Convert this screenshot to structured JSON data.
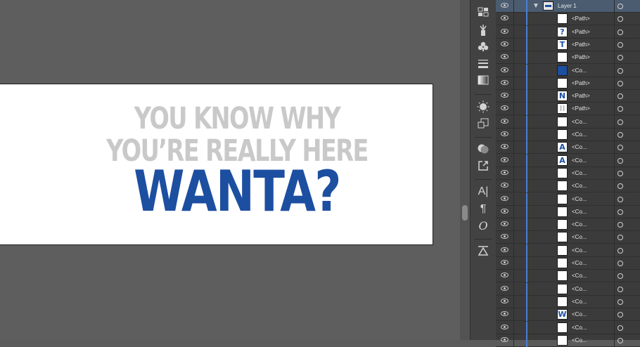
{
  "artboard": {
    "line1": "YOU KNOW WHY",
    "line2": "YOU’RE REALLY HERE",
    "line3": "WANTA?"
  },
  "tools": [
    "swatch-grid-icon",
    "brush-library-icon",
    "symbols-icon",
    "stroke-icon",
    "gradient-icon",
    "appearance-icon",
    "graphic-styles-icon",
    "pathfinder-icon",
    "export-icon",
    "character-icon",
    "paragraph-icon",
    "opentype-icon",
    "align-icon"
  ],
  "tool_glyphs": {
    "character": "A|",
    "paragraph": "¶",
    "opentype": "O"
  },
  "layers": {
    "top_layer": "Layer 1",
    "rows": [
      {
        "name": "<Path>",
        "thumb": "",
        "kind": "white"
      },
      {
        "name": "<Path>",
        "thumb": "?",
        "kind": "letter"
      },
      {
        "name": "<Path>",
        "thumb": "T",
        "kind": "letter"
      },
      {
        "name": "<Path>",
        "thumb": "",
        "kind": "white"
      },
      {
        "name": "<Co...",
        "thumb": "",
        "kind": "blue"
      },
      {
        "name": "<Path>",
        "thumb": "",
        "kind": "white"
      },
      {
        "name": "<Path>",
        "thumb": "N",
        "kind": "letter"
      },
      {
        "name": "<Path>",
        "thumb": "II",
        "kind": "gray"
      },
      {
        "name": "<Co...",
        "thumb": "",
        "kind": "white"
      },
      {
        "name": "<Co...",
        "thumb": "",
        "kind": "white"
      },
      {
        "name": "<Co...",
        "thumb": "A",
        "kind": "letter"
      },
      {
        "name": "<Co...",
        "thumb": "A",
        "kind": "letter"
      },
      {
        "name": "<Co...",
        "thumb": "",
        "kind": "white"
      },
      {
        "name": "<Co...",
        "thumb": "",
        "kind": "white"
      },
      {
        "name": "<Co...",
        "thumb": "",
        "kind": "white"
      },
      {
        "name": "<Co...",
        "thumb": "",
        "kind": "white"
      },
      {
        "name": "<Co...",
        "thumb": "",
        "kind": "white"
      },
      {
        "name": "<Co...",
        "thumb": "",
        "kind": "white"
      },
      {
        "name": "<Co...",
        "thumb": "",
        "kind": "white"
      },
      {
        "name": "<Co...",
        "thumb": "",
        "kind": "white"
      },
      {
        "name": "<Co...",
        "thumb": "",
        "kind": "white"
      },
      {
        "name": "<Co...",
        "thumb": "",
        "kind": "white"
      },
      {
        "name": "<Co...",
        "thumb": "",
        "kind": "white"
      },
      {
        "name": "<Co...",
        "thumb": "W",
        "kind": "letter"
      },
      {
        "name": "<Co...",
        "thumb": "",
        "kind": "white"
      },
      {
        "name": "<Co...",
        "thumb": "",
        "kind": "white"
      }
    ]
  },
  "colors": {
    "art_blue": "#1d4fa1",
    "art_gray": "#c9c9c9",
    "layer_color": "#4a7fd6"
  }
}
